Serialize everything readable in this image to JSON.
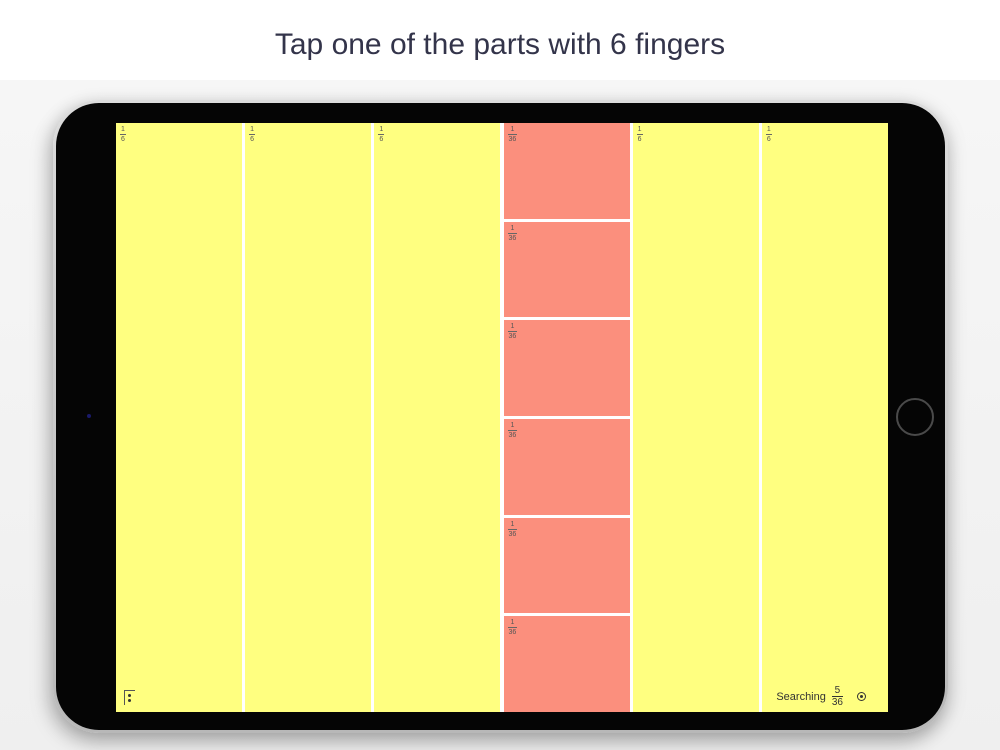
{
  "caption": "Tap one of the parts with 6 fingers",
  "colors": {
    "whole_part": "#ffff80",
    "sub_part": "#fb8f7d",
    "divider": "#ffffff"
  },
  "columns": [
    {
      "numerator": "1",
      "denominator": "6",
      "split": false
    },
    {
      "numerator": "1",
      "denominator": "6",
      "split": false
    },
    {
      "numerator": "1",
      "denominator": "6",
      "split": false
    },
    {
      "split": true,
      "parts": [
        {
          "numerator": "1",
          "denominator": "36"
        },
        {
          "numerator": "1",
          "denominator": "36"
        },
        {
          "numerator": "1",
          "denominator": "36"
        },
        {
          "numerator": "1",
          "denominator": "36"
        },
        {
          "numerator": "1",
          "denominator": "36"
        },
        {
          "numerator": "1",
          "denominator": "36"
        }
      ]
    },
    {
      "numerator": "1",
      "denominator": "6",
      "split": false
    },
    {
      "numerator": "1",
      "denominator": "6",
      "split": false
    }
  ],
  "status": {
    "label": "Searching",
    "numerator": "5",
    "denominator": "36"
  },
  "icons": {
    "corner_menu": "dots-menu-icon",
    "status_target": "target-icon"
  }
}
